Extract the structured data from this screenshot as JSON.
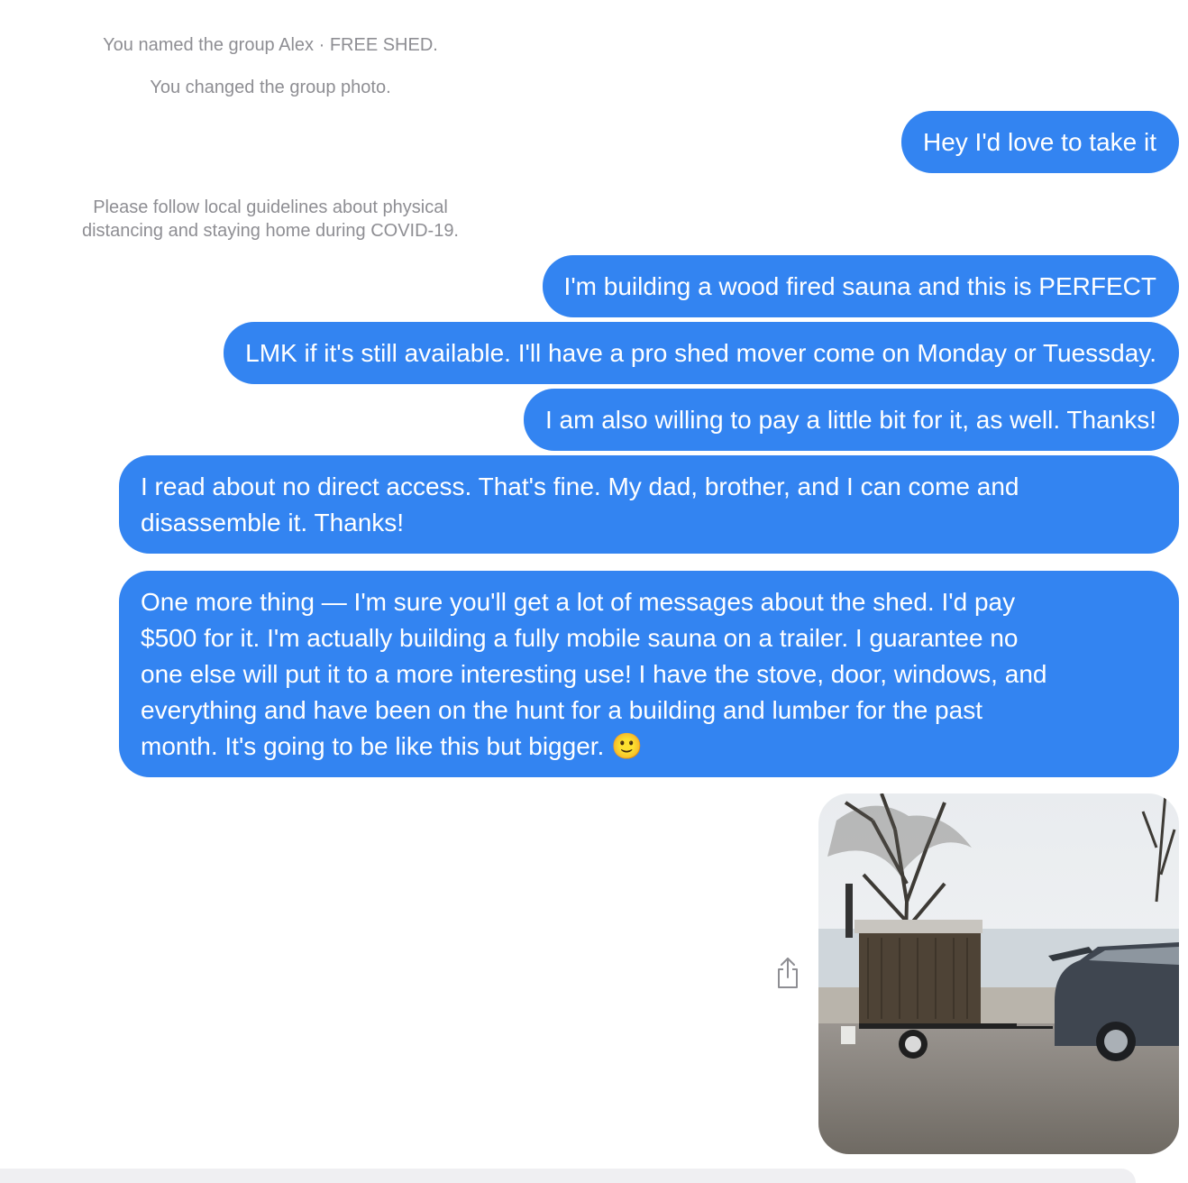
{
  "conversation": {
    "system_messages": [
      "You named the group Alex · FREE SHED.",
      "You changed the group photo.",
      "Please follow local guidelines about physical\ndistancing and staying home during COVID-19."
    ],
    "messages": [
      {
        "text": "Hey I'd love to take it"
      },
      {
        "text": "I'm building a wood fired sauna and this is PERFECT"
      },
      {
        "text": "LMK if it's still available. I'll have a pro shed mover come on Monday or Tuessday."
      },
      {
        "text": "I am also willing to pay a little bit for it, as well. Thanks!"
      },
      {
        "text": "I read about no direct access. That's fine. My dad, brother, and I can come and\ndisassemble it. Thanks!"
      },
      {
        "text": "One more thing —  I'm sure you'll get a lot of messages about the shed. I'd pay\n$500 for it. I'm actually building a fully mobile sauna on a trailer. I guarantee no\none else will put it to a more interesting use! I have the stove, door, windows, and\neverything and have been on the hunt for a building and lumber for the past\nmonth. It's going to be like this but bigger. 🙂"
      }
    ],
    "attachment": {
      "icon": "share-icon",
      "image": "photo-of-mobile-sauna-trailer-and-car"
    }
  },
  "colors": {
    "bubble": "#3384f1",
    "bubble_text": "#ffffff",
    "system_text": "#8e8e93"
  }
}
